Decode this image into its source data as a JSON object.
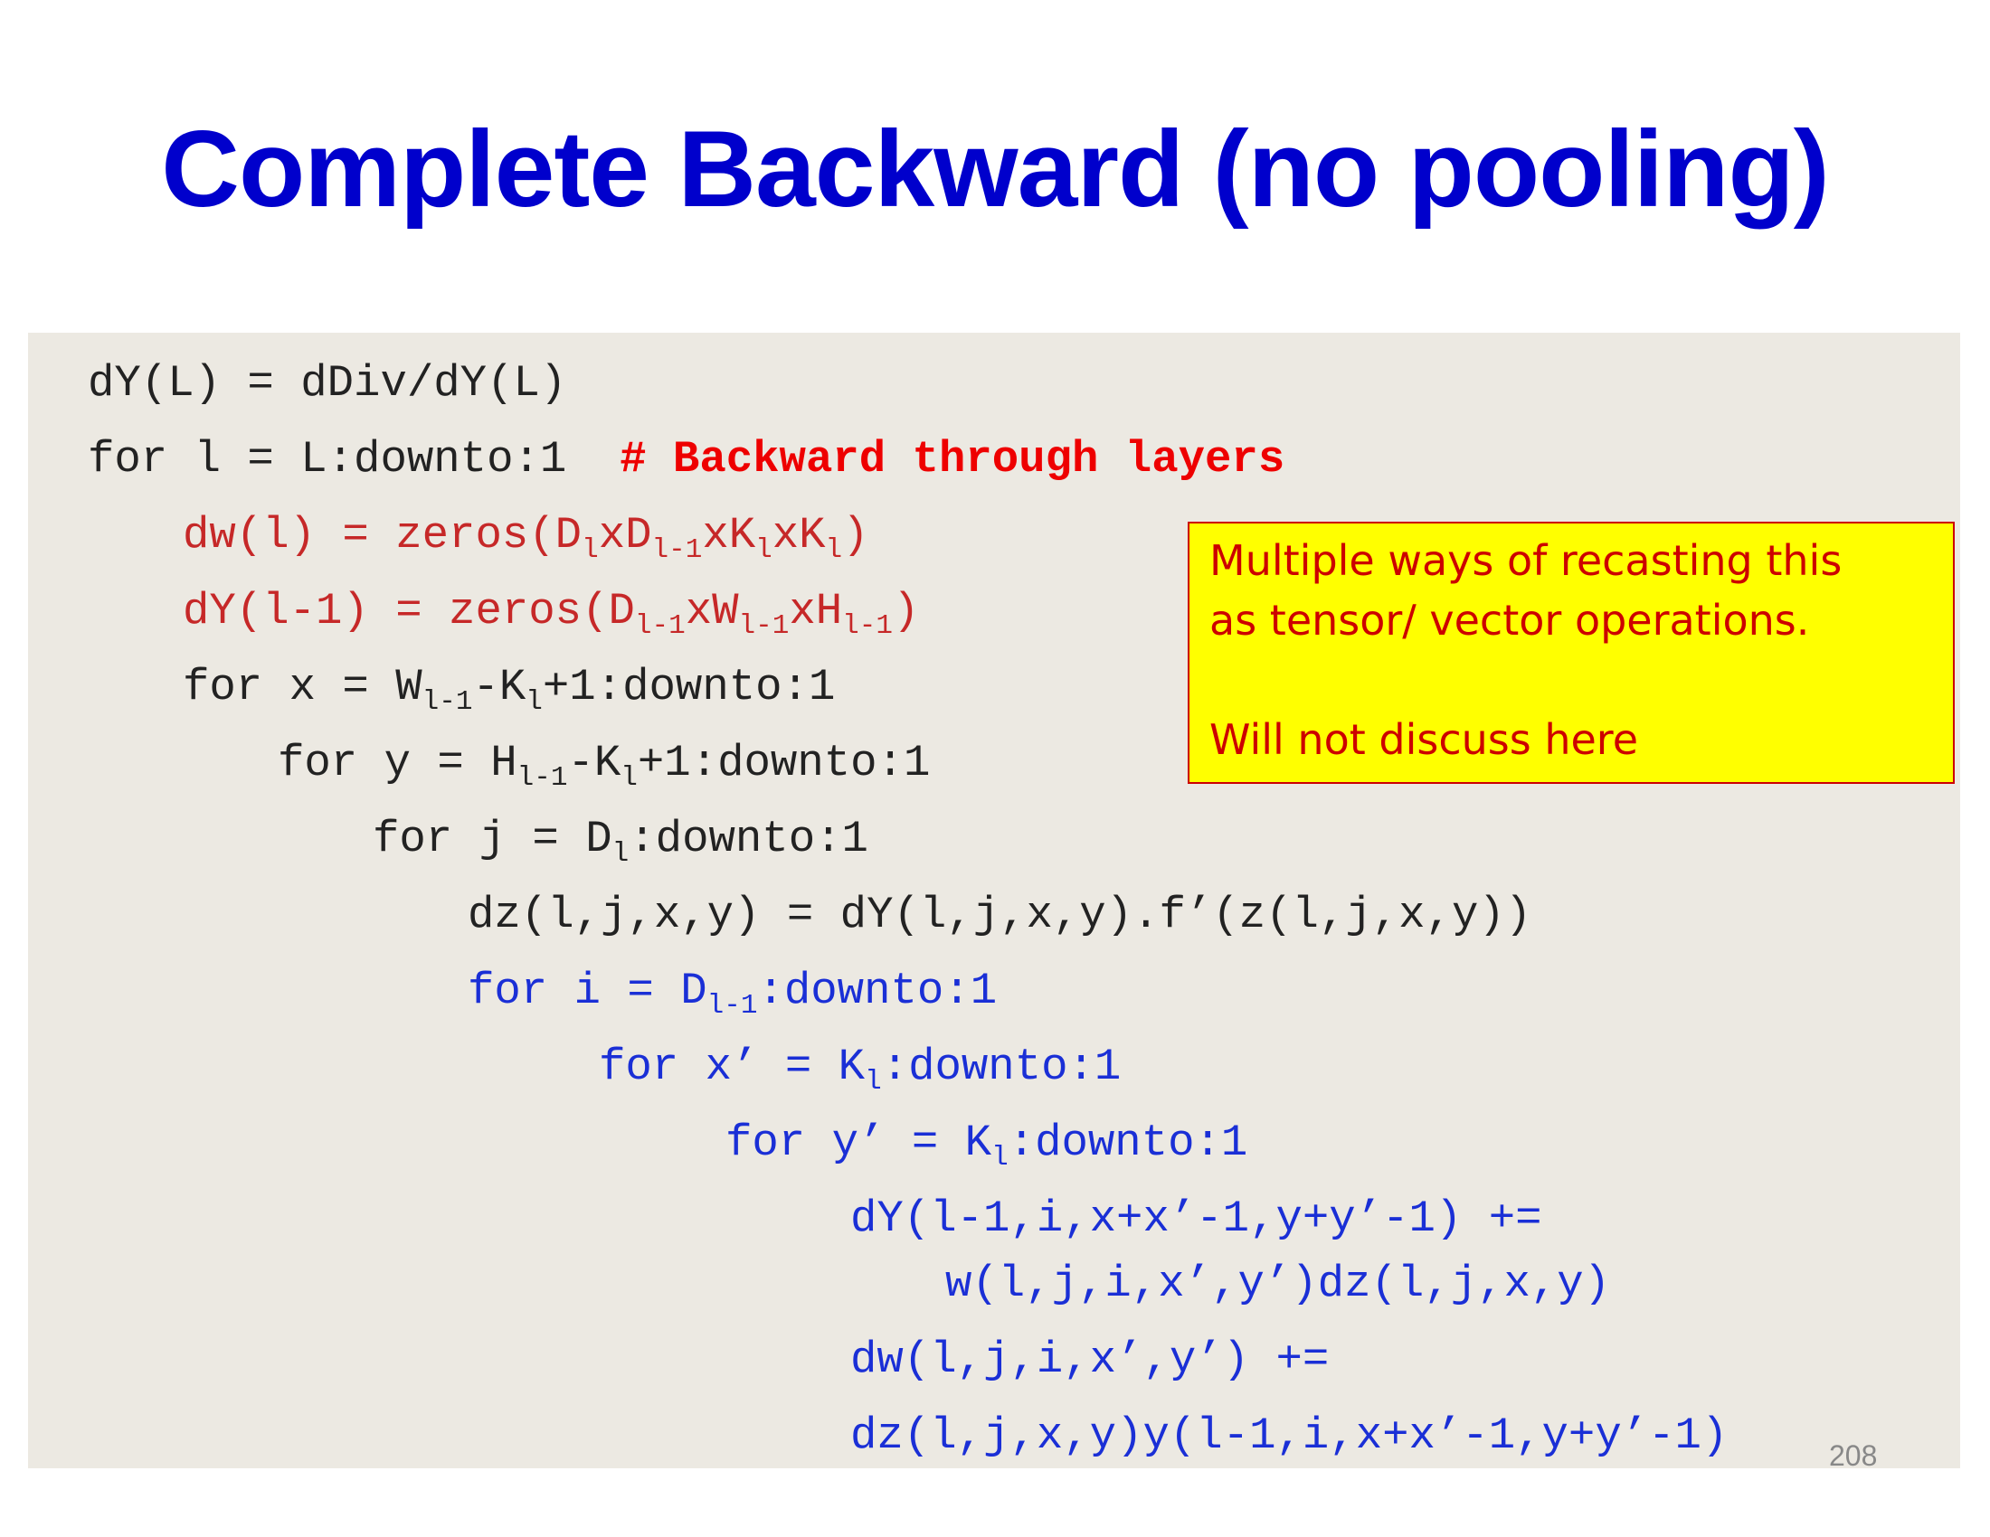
{
  "title": "Complete Backward (no pooling)",
  "code": {
    "l1": "dY(L) = dDiv/dY(L)",
    "l2": "for l = L:downto:1",
    "l2_comment": "# Backward through layers",
    "l3_a": "dw(l) = zeros(D",
    "l3_s1": "l",
    "l3_b": "xD",
    "l3_s2": "l-1",
    "l3_c": "xK",
    "l3_s3": "l",
    "l3_d": "xK",
    "l3_s4": "l",
    "l3_e": ")",
    "l4_a": "dY(l-1) = zeros(D",
    "l4_s1": "l-1",
    "l4_b": "xW",
    "l4_s2": "l-1",
    "l4_c": "xH",
    "l4_s3": "l-1",
    "l4_d": ")",
    "l5_a": "for x = W",
    "l5_s1": "l-1",
    "l5_b": "-K",
    "l5_s2": "l",
    "l5_c": "+1:downto:1",
    "l6_a": "for y = H",
    "l6_s1": "l-1",
    "l6_b": "-K",
    "l6_s2": "l",
    "l6_c": "+1:downto:1",
    "l7_a": "for j = D",
    "l7_s1": "l",
    "l7_b": ":downto:1",
    "l8": "dz(l,j,x,y) = dY(l,j,x,y).f’(z(l,j,x,y))",
    "l9_a": "for i = D",
    "l9_s1": "l-1",
    "l9_b": ":downto:1",
    "l10_a": "for x’ = K",
    "l10_s1": "l",
    "l10_b": ":downto:1",
    "l11_a": "for y’ = K",
    "l11_s1": "l",
    "l11_b": ":downto:1",
    "l12": "dY(l-1,i,x+x’-1,y+y’-1) +=",
    "l13": "w(l,j,i,x’,y’)dz(l,j,x,y)",
    "l14": "dw(l,j,i,x’,y’) +=",
    "l15": "dz(l,j,x,y)y(l-1,i,x+x’-1,y+y’-1)"
  },
  "note": {
    "line1": "Multiple ways of recasting this",
    "line2": "as tensor/ vector operations.",
    "line3": "Will not discuss here"
  },
  "page_number": "208",
  "colors": {
    "title": "#0000cc",
    "code_background": "#ece9e2",
    "comment": "#ee0000",
    "red_code": "#c62828",
    "blue_code": "#1a2fd6",
    "note_background": "#ffff00",
    "note_text": "#cc0000"
  }
}
